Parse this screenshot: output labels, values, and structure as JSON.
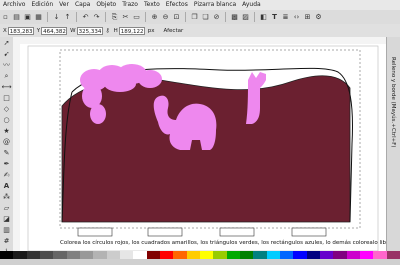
{
  "menu": [
    "Archivo",
    "Edición",
    "Ver",
    "Capa",
    "Objeto",
    "Trazo",
    "Texto",
    "Efectos",
    "Pizarra blanca",
    "Ayuda"
  ],
  "toolbar": {
    "icons": [
      "new-icon",
      "open-icon",
      "save-icon",
      "print-icon",
      "import-icon",
      "export-icon",
      "undo-icon",
      "redo-icon",
      "copy-icon",
      "cut-icon",
      "paste-icon",
      "zoom-in-icon",
      "zoom-out-icon",
      "zoom-fit-icon",
      "duplicate-icon",
      "clone-icon",
      "unlink-icon",
      "group-icon",
      "ungroup-icon",
      "fill-stroke-icon",
      "text-icon",
      "layers-icon",
      "xml-editor-icon",
      "align-icon",
      "preferences-icon"
    ]
  },
  "controls": {
    "x_label": "X",
    "x_value": "183,283",
    "y_label": "Y",
    "y_value": "464,382",
    "w_label": "W",
    "w_value": "325,334",
    "h_label": "H",
    "h_value": "189,122",
    "units": "px",
    "affect_label": "Afectar"
  },
  "side_panel_label": "Relleno y borde (Mayús.+Ctrl+F)",
  "canvas": {
    "caption": "Colorea los círculos rojos, los cuadrados amarillos, los triángulos verdes, los rectángulos azules, lo demás colorealo libremente sin"
  },
  "colors": {
    "hill": "#6b2030",
    "pink": "#ee88ee",
    "palette": [
      "#000000",
      "#1a1a1a",
      "#333333",
      "#4d4d4d",
      "#666666",
      "#808080",
      "#999999",
      "#b3b3b3",
      "#cccccc",
      "#e6e6e6",
      "#ffffff",
      "#800000",
      "#ff0000",
      "#ff6600",
      "#ffcc00",
      "#ffff00",
      "#99cc00",
      "#00aa00",
      "#008000",
      "#008080",
      "#00ccff",
      "#0066ff",
      "#0000ff",
      "#000080",
      "#6600cc",
      "#800080",
      "#cc00cc",
      "#ff00ff",
      "#ff66cc",
      "#993366"
    ]
  },
  "tools": [
    "select-tool-icon",
    "node-tool-icon",
    "tweak-tool-icon",
    "zoom-tool-icon",
    "measure-tool-icon",
    "rect-tool-icon",
    "3dbox-tool-icon",
    "ellipse-tool-icon",
    "star-tool-icon",
    "spiral-tool-icon",
    "pencil-tool-icon",
    "pen-tool-icon",
    "calligraphy-tool-icon",
    "text-tool-icon",
    "spray-tool-icon",
    "eraser-tool-icon",
    "bucket-tool-icon",
    "gradient-tool-icon",
    "mesh-tool-icon",
    "dropper-tool-icon",
    "connector-tool-icon"
  ]
}
